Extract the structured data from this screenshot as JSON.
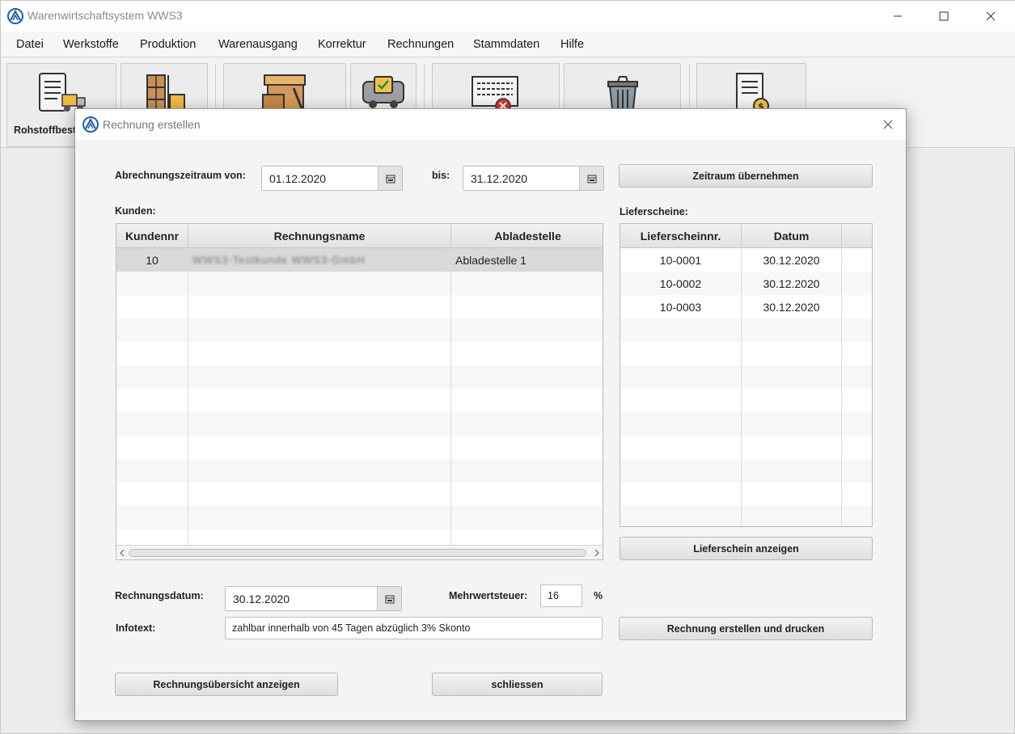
{
  "window": {
    "title": "Warenwirtschaftsystem WWS3"
  },
  "menu": [
    "Datei",
    "Werkstoffe",
    "Produktion",
    "Warenausgang",
    "Korrektur",
    "Rechnungen",
    "Stammdaten",
    "Hilfe"
  ],
  "toolbar": {
    "first_label": "Rohstoffbest"
  },
  "dialog": {
    "title": "Rechnung erstellen",
    "period_from_label": "Abrechnungszeitraum von:",
    "period_from": "01.12.2020",
    "period_to_label": "bis:",
    "period_to": "31.12.2020",
    "apply_period_button": "Zeitraum übernehmen",
    "customers_label": "Kunden:",
    "customers_table": {
      "headers": [
        "Kundennr",
        "Rechnungsname",
        "Abladestelle"
      ],
      "rows": [
        {
          "nr": "10",
          "name": "WWS3-Testkunde WWS3-GmbH",
          "place": "Abladestelle 1"
        }
      ]
    },
    "delivery_notes_label": "Lieferscheine:",
    "delivery_table": {
      "headers": [
        "Lieferscheinnr.",
        "Datum"
      ],
      "rows": [
        {
          "nr": "10-0001",
          "date": "30.12.2020"
        },
        {
          "nr": "10-0002",
          "date": "30.12.2020"
        },
        {
          "nr": "10-0003",
          "date": "30.12.2020"
        }
      ]
    },
    "show_delivery_button": "Lieferschein anzeigen",
    "invoice_date_label": "Rechnungsdatum:",
    "invoice_date": "30.12.2020",
    "vat_label": "Mehrwertsteuer:",
    "vat_value": "16",
    "vat_unit": "%",
    "infotext_label": "Infotext:",
    "infotext_value": "zahlbar innerhalb von 45 Tagen abzüglich 3% Skonto",
    "create_print_button": "Rechnung erstellen und drucken",
    "overview_button": "Rechnungsübersicht anzeigen",
    "close_button": "schliessen"
  },
  "colors": {
    "selected_row": "#d9d9d9",
    "alt_row": "#f7f7f7",
    "accent": "#1f5fa8"
  }
}
